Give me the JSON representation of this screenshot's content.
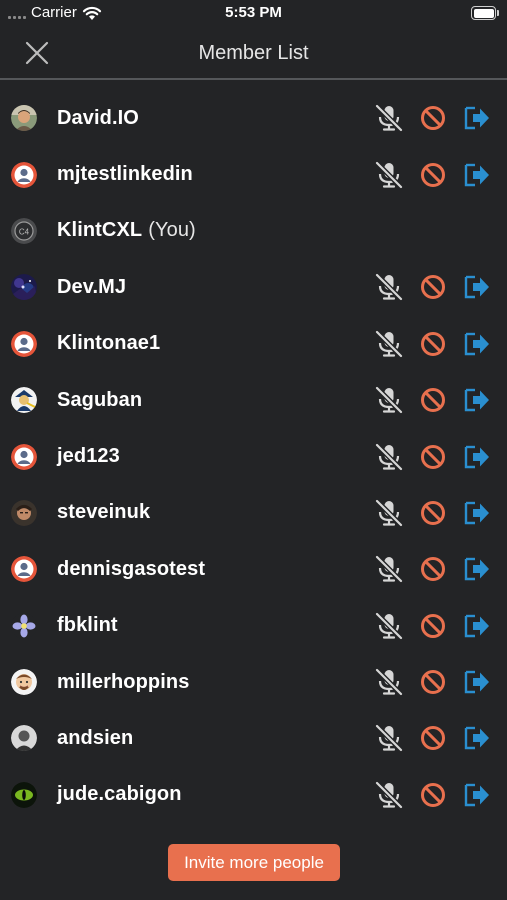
{
  "status_bar": {
    "carrier": "Carrier",
    "time": "5:53 PM"
  },
  "header": {
    "title": "Member List",
    "close_icon": "close-icon"
  },
  "colors": {
    "background": "#232426",
    "mute_icon": "#d6d6d6",
    "block_icon": "#e8704e",
    "kick_icon": "#2a8fd0",
    "invite_button": "#e8704e"
  },
  "members": [
    {
      "name": "David.IO",
      "avatar": "photo-man",
      "is_you": false
    },
    {
      "name": "mjtestlinkedin",
      "avatar": "default-user",
      "is_you": false
    },
    {
      "name": "KlintCXL",
      "avatar": "logo-gray",
      "is_you": true,
      "you_label": "(You)"
    },
    {
      "name": "Dev.MJ",
      "avatar": "photo-galaxy",
      "is_you": false
    },
    {
      "name": "Klintonae1",
      "avatar": "default-user",
      "is_you": false
    },
    {
      "name": "Saguban",
      "avatar": "photo-cartoon",
      "is_you": false
    },
    {
      "name": "jed123",
      "avatar": "default-user",
      "is_you": false
    },
    {
      "name": "steveinuk",
      "avatar": "photo-face",
      "is_you": false
    },
    {
      "name": "dennisgasotest",
      "avatar": "default-user",
      "is_you": false
    },
    {
      "name": "fbklint",
      "avatar": "flower",
      "is_you": false
    },
    {
      "name": "millerhoppins",
      "avatar": "emoji-face",
      "is_you": false
    },
    {
      "name": "andsien",
      "avatar": "photo-bw",
      "is_you": false
    },
    {
      "name": "jude.cabigon",
      "avatar": "cat-eye",
      "is_you": false
    }
  ],
  "row_actions": {
    "mute_icon": "mic-off-icon",
    "block_icon": "block-icon",
    "kick_icon": "kick-exit-icon"
  },
  "invite_button_label": "Invite more people"
}
